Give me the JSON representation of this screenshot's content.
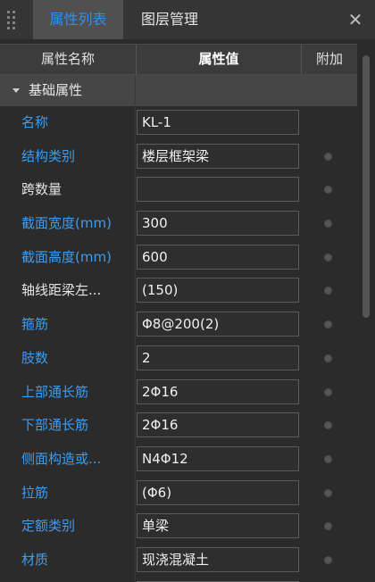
{
  "tabs": {
    "active": "属性列表",
    "inactive": "图层管理"
  },
  "header": {
    "name_col": "属性名称",
    "value_col": "属性值",
    "extra_col": "附加"
  },
  "section": {
    "label": "基础属性"
  },
  "rows": [
    {
      "name": "名称",
      "value": "KL-1",
      "color": "blue",
      "has_dot": false
    },
    {
      "name": "结构类别",
      "value": "楼层框架梁",
      "color": "blue",
      "has_dot": true
    },
    {
      "name": "跨数量",
      "value": "",
      "color": "white",
      "has_dot": true
    },
    {
      "name": "截面宽度(mm)",
      "value": "300",
      "color": "blue",
      "has_dot": true
    },
    {
      "name": "截面高度(mm)",
      "value": "600",
      "color": "blue",
      "has_dot": true
    },
    {
      "name": "轴线距梁左...",
      "value": "(150)",
      "color": "white",
      "has_dot": true
    },
    {
      "name": "箍筋",
      "value": "Φ8@200(2)",
      "color": "blue",
      "has_dot": true
    },
    {
      "name": "肢数",
      "value": "2",
      "color": "blue",
      "has_dot": true
    },
    {
      "name": "上部通长筋",
      "value": "2Φ16",
      "color": "blue",
      "has_dot": true
    },
    {
      "name": "下部通长筋",
      "value": "2Φ16",
      "color": "blue",
      "has_dot": true
    },
    {
      "name": "侧面构造或...",
      "value": "N4Φ12",
      "color": "blue",
      "has_dot": true
    },
    {
      "name": "拉筋",
      "value": "(Φ6)",
      "color": "blue",
      "has_dot": true
    },
    {
      "name": "定额类别",
      "value": "单梁",
      "color": "blue",
      "has_dot": true
    },
    {
      "name": "材质",
      "value": "现浇混凝土",
      "color": "blue",
      "has_dot": true
    },
    {
      "name": "",
      "value": "",
      "color": "white",
      "has_dot": false
    }
  ],
  "colors": {
    "accent": "#2f8ff0",
    "label_blue": "#3d9cf0"
  }
}
